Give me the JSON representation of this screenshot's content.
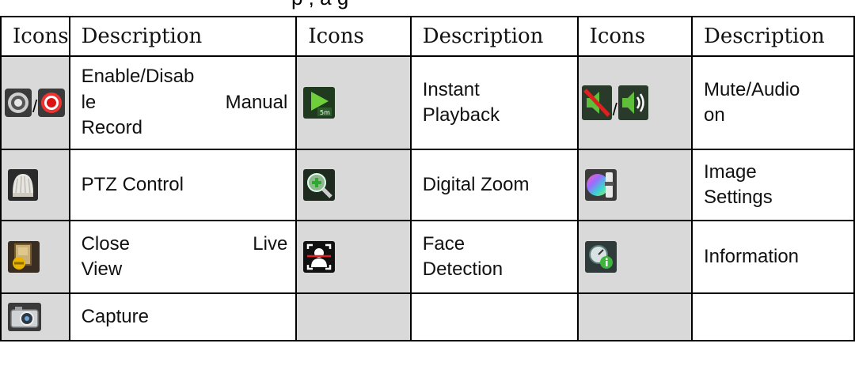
{
  "header_partial": "p , a       g",
  "table": {
    "headers": [
      "Icons",
      "Description",
      "Icons",
      "Description",
      "Icons",
      "Description"
    ],
    "rows": [
      [
        {
          "icons": [
            "record-off-icon",
            "record-on-icon"
          ],
          "separator": "/"
        },
        {
          "text": "Enable/Disable Manual Record"
        },
        {
          "icons": [
            "instant-playback-icon"
          ]
        },
        {
          "text": "Instant Playback"
        },
        {
          "icons": [
            "mute-icon",
            "audio-on-icon"
          ],
          "separator": "/"
        },
        {
          "text": "Mute/Audio on"
        }
      ],
      [
        {
          "icons": [
            "ptz-control-icon"
          ]
        },
        {
          "text": "PTZ Control"
        },
        {
          "icons": [
            "digital-zoom-icon"
          ]
        },
        {
          "text": "Digital Zoom"
        },
        {
          "icons": [
            "image-settings-icon"
          ]
        },
        {
          "text": "Image Settings"
        }
      ],
      [
        {
          "icons": [
            "close-live-view-icon"
          ]
        },
        {
          "text": "Close Live View"
        },
        {
          "icons": [
            "face-detection-icon"
          ]
        },
        {
          "text": "Face Detection"
        },
        {
          "icons": [
            "information-icon"
          ]
        },
        {
          "text": "Information"
        }
      ],
      [
        {
          "icons": [
            "capture-icon"
          ]
        },
        {
          "text": "Capture"
        },
        {
          "icons": []
        },
        {
          "text": ""
        },
        {
          "icons": []
        },
        {
          "text": ""
        }
      ]
    ],
    "desc_lines": {
      "enable_1": "Enable/Disab",
      "enable_2": "le",
      "enable_2b": "Manual",
      "enable_3": "Record",
      "instant_1": "Instant",
      "instant_2": "Playback",
      "mute_1": "Mute/Audio",
      "mute_2": "on",
      "ptz": "PTZ Control",
      "zoom": "Digital Zoom",
      "image_1": "Image",
      "image_2": "Settings",
      "close_1": "Close",
      "close_1b": "Live",
      "close_2": "View",
      "face_1": "Face",
      "face_2": "Detection",
      "info": "Information",
      "capture": "Capture"
    }
  }
}
